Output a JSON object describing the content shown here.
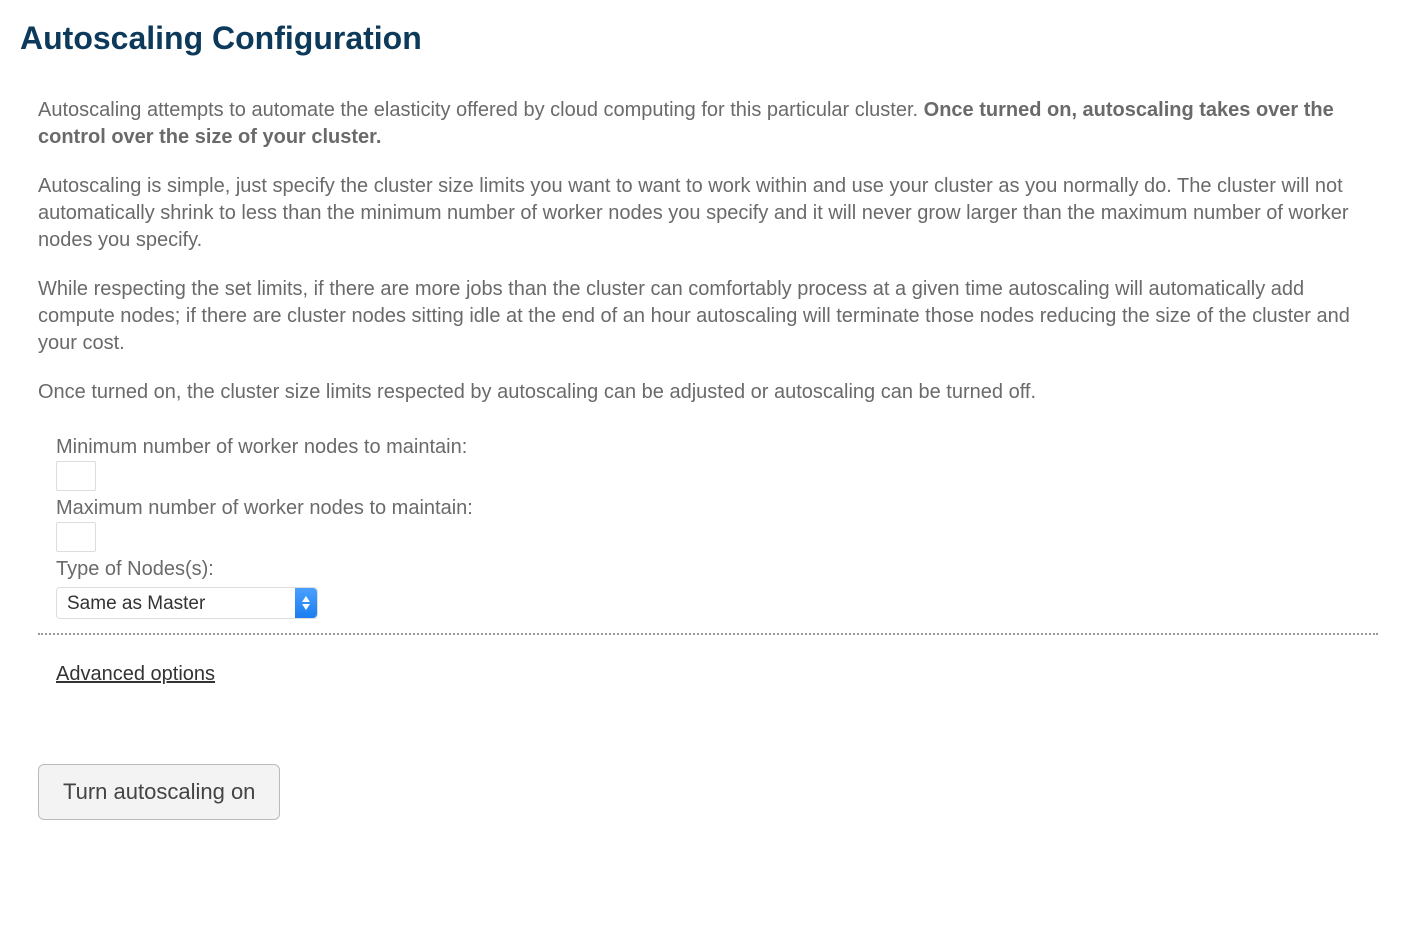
{
  "title": "Autoscaling Configuration",
  "description": {
    "p1_text": "Autoscaling attempts to automate the elasticity offered by cloud computing for this particular cluster. ",
    "p1_bold": "Once turned on, autoscaling takes over the control over the size of your cluster.",
    "p2": "Autoscaling is simple, just specify the cluster size limits you want to want to work within and use your cluster as you normally do. The cluster will not automatically shrink to less than the minimum number of worker nodes you specify and it will never grow larger than the maximum number of worker nodes you specify.",
    "p3": "While respecting the set limits, if there are more jobs than the cluster can comfortably process at a given time autoscaling will automatically add compute nodes; if there are cluster nodes sitting idle at the end of an hour autoscaling will terminate those nodes reducing the size of the cluster and your cost.",
    "p4": "Once turned on, the cluster size limits respected by autoscaling can be adjusted or autoscaling can be turned off."
  },
  "form": {
    "min_label": "Minimum number of worker nodes to maintain:",
    "min_value": "",
    "max_label": "Maximum number of worker nodes to maintain:",
    "max_value": "",
    "type_label": "Type of Nodes(s):",
    "type_selected": "Same as Master",
    "advanced_label": "Advanced options",
    "submit_label": "Turn autoscaling on"
  }
}
